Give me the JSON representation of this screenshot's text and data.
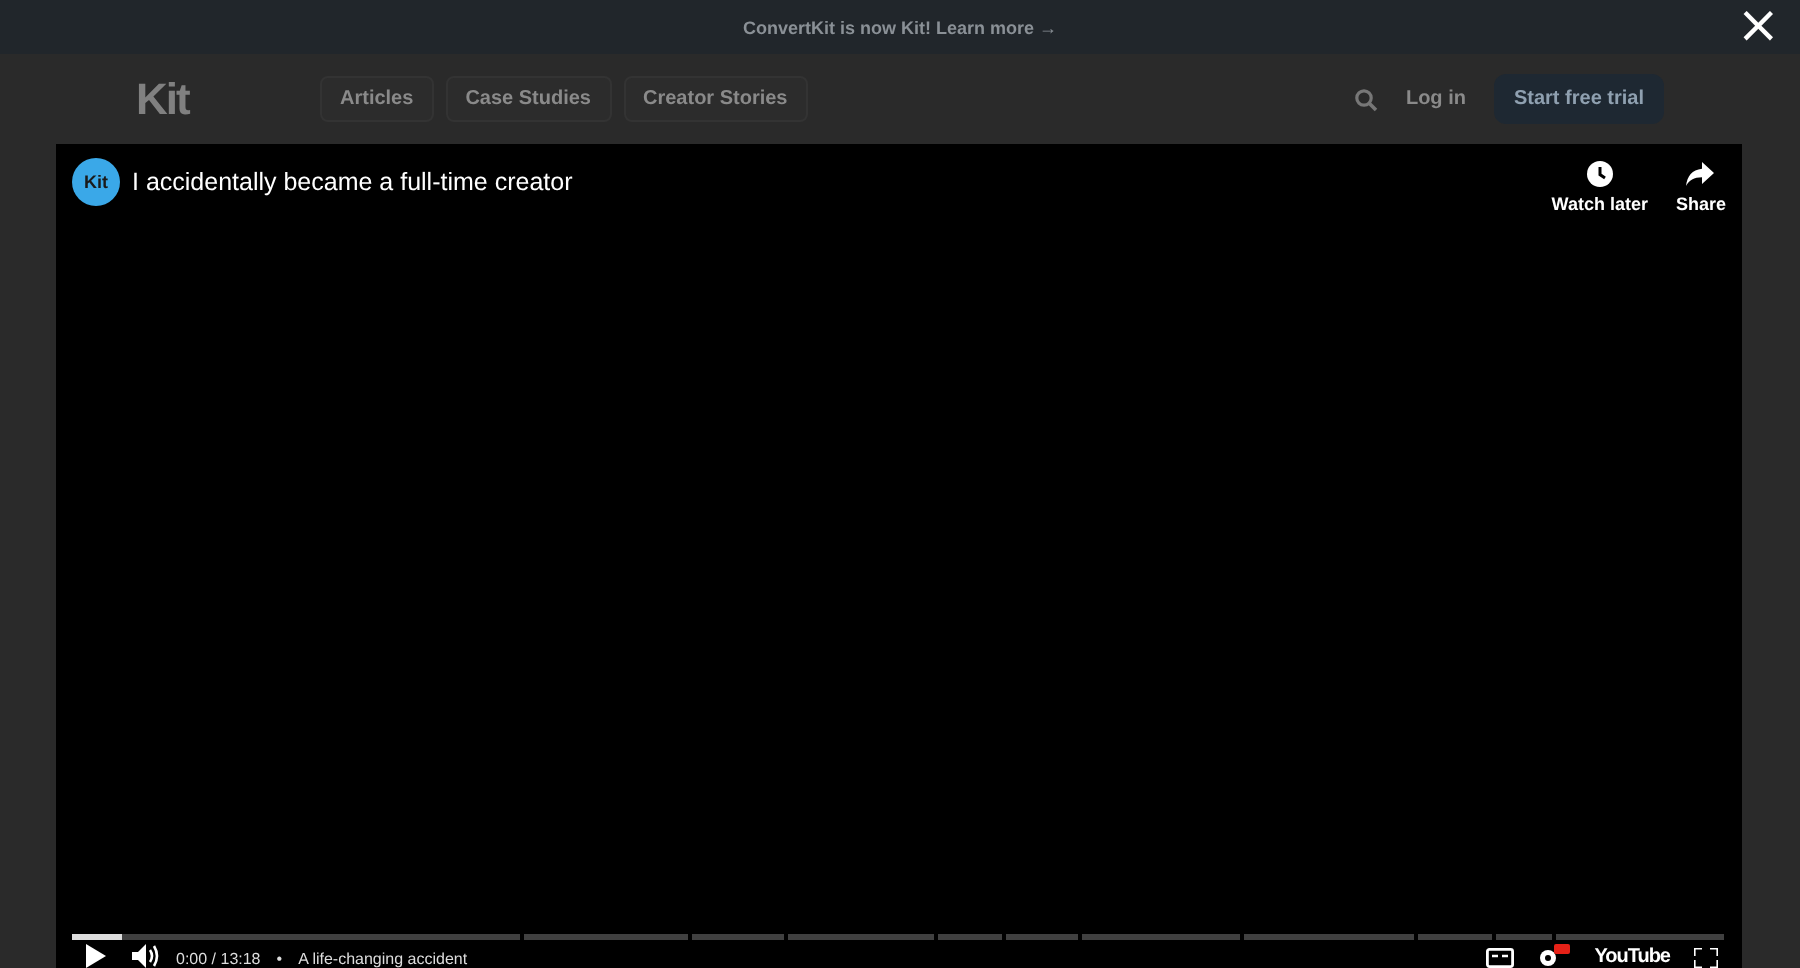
{
  "banner": {
    "text": "ConvertKit is now Kit! Learn more →"
  },
  "header": {
    "logo": "Kit",
    "nav": [
      "Articles",
      "Case Studies",
      "Creator Stories"
    ],
    "login": "Log in",
    "cta": "Start free trial"
  },
  "close_button": {
    "label": "×"
  },
  "video": {
    "channel_logo": "Kit",
    "title": "I accidentally became a full-time creator",
    "actions": [
      {
        "kind": "clock",
        "label": "Watch later"
      },
      {
        "kind": "share",
        "label": "Share"
      }
    ],
    "progress": {
      "level": 0.03
    },
    "time": "0:00 / 13:18",
    "separator": "•",
    "chapter": "A life-changing accident",
    "brand": "YouTube"
  }
}
